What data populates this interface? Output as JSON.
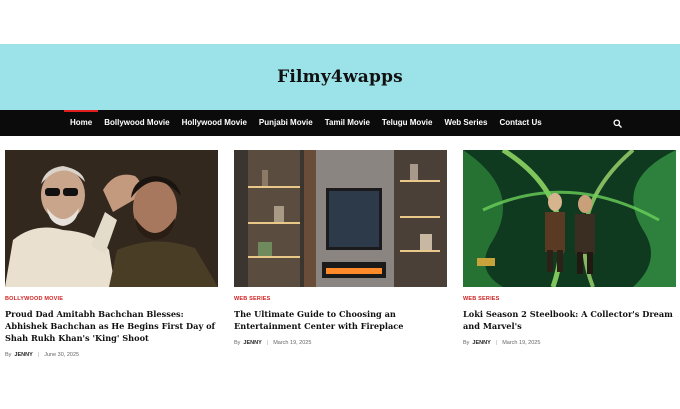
{
  "site": {
    "title": "Filmy4wapps"
  },
  "nav": {
    "items": [
      {
        "label": "Home",
        "active": true
      },
      {
        "label": "Bollywood Movie"
      },
      {
        "label": "Hollywood Movie"
      },
      {
        "label": "Punjabi Movie"
      },
      {
        "label": "Tamil Movie"
      },
      {
        "label": "Telugu Movie"
      },
      {
        "label": "Web Series"
      },
      {
        "label": "Contact Us"
      }
    ],
    "search_icon": "search-icon"
  },
  "posts": [
    {
      "category": "BOLLYWOOD MOVIE",
      "title": "Proud Dad Amitabh Bachchan Blesses: Abhishek Bachchan as He Begins First Day of Shah Rukh Khan's 'King' Shoot",
      "by": "By",
      "author": "JENNY",
      "date": "June 30, 2025"
    },
    {
      "category": "WEB SERIES",
      "title": "The Ultimate Guide to Choosing an Entertainment Center with Fireplace",
      "by": "By",
      "author": "JENNY",
      "date": "March 19, 2025"
    },
    {
      "category": "WEB SERIES",
      "title": "Loki Season 2 Steelbook: A Collector's Dream and Marvel's",
      "by": "By",
      "author": "JENNY",
      "date": "March 19, 2025"
    }
  ],
  "colors": {
    "header_band": "#9be3e8",
    "nav_bg": "#0b0b0b",
    "accent": "#e11d1d",
    "category": "#d11f1f"
  }
}
